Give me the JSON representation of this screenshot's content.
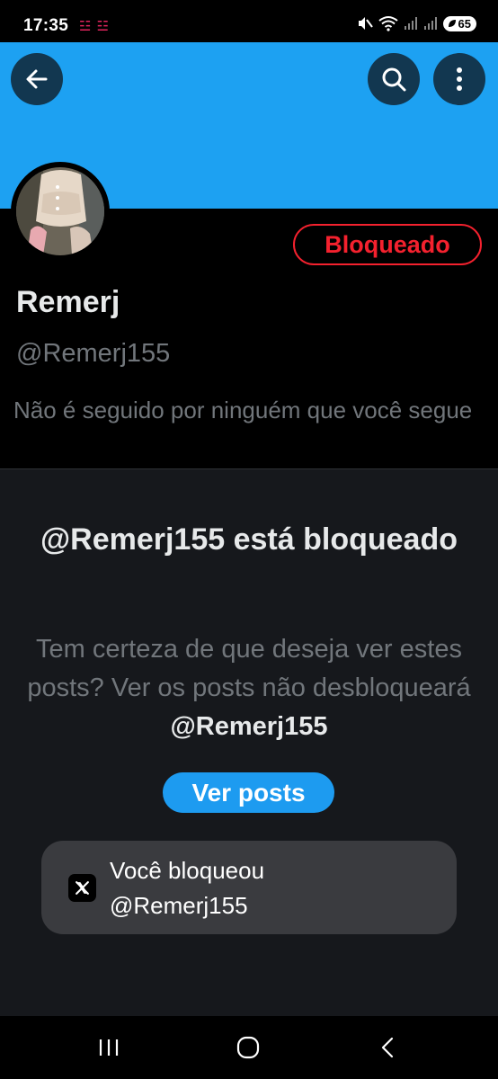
{
  "status_bar": {
    "time": "17:35",
    "notification_glyphs": "☳ ☳",
    "battery_level": "65",
    "icons": [
      "mute-icon",
      "wifi-icon",
      "signal-icon",
      "signal-icon",
      "battery-icon"
    ]
  },
  "colors": {
    "banner": "#1da1f2",
    "accent": "#1d9bf0",
    "blocked_red": "#f4212e",
    "panel_bg": "#16181c",
    "toast_bg": "#3a3b3f"
  },
  "header": {
    "back_icon": "arrow-left-icon",
    "search_icon": "search-icon",
    "more_icon": "more-vertical-icon"
  },
  "profile": {
    "blocked_label": "Bloqueado",
    "display_name": "Remerj",
    "handle": "@Remerj155",
    "followers_note": "Não é seguido por ninguém que você segue"
  },
  "blocked_panel": {
    "title": "@Remerj155 está bloqueado",
    "description": "Tem certeza de que deseja ver estes posts? Ver os posts não desbloqueará",
    "description_handle": "@Remerj155",
    "view_posts_label": "Ver posts"
  },
  "toast": {
    "logo_icon": "x-logo-icon",
    "line1": "Você bloqueou",
    "line2": "@Remerj155"
  },
  "nav_bar": {
    "icons": [
      "recent-apps-icon",
      "home-icon",
      "back-icon"
    ]
  }
}
